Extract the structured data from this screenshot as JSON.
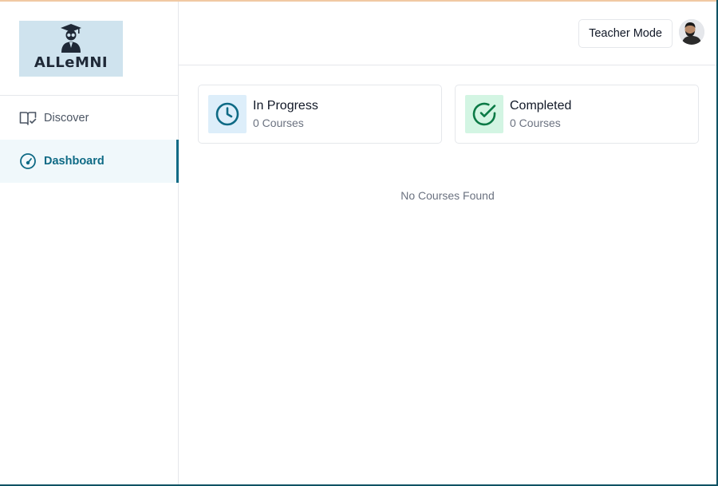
{
  "brand": {
    "logo_text": "ALLeMNI",
    "logo_bg": "#cfe3ee"
  },
  "sidebar": {
    "items": [
      {
        "label": "Discover",
        "icon": "book-check-icon",
        "active": false
      },
      {
        "label": "Dashboard",
        "icon": "gauge-icon",
        "active": true
      }
    ]
  },
  "header": {
    "mode_button": "Teacher Mode",
    "avatar": "user-avatar"
  },
  "stats": [
    {
      "title": "In Progress",
      "subtitle": "0 Courses",
      "icon": "clock-icon",
      "color": "#0e6a85"
    },
    {
      "title": "Completed",
      "subtitle": "0 Courses",
      "icon": "check-circle-icon",
      "color": "#0b7a46"
    }
  ],
  "main": {
    "empty_message": "No Courses Found"
  },
  "colors": {
    "accent": "#0e6a85",
    "border": "#e5e7eb",
    "muted_text": "#6b7280"
  }
}
